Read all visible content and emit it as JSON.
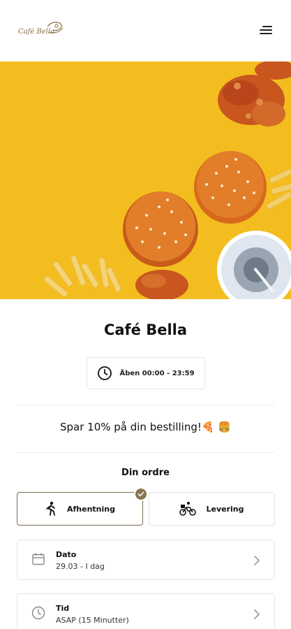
{
  "header": {
    "logo_text": "Café Bella",
    "menu_icon": "hamburger-menu-icon"
  },
  "hero": {
    "icon": "food-banner-image"
  },
  "restaurant": {
    "name": "Café Bella",
    "hours": "Åben 00:00 - 23:59"
  },
  "promo": {
    "text": "Spar 10% på din bestilling!🍕 🍔"
  },
  "order": {
    "title": "Din ordre",
    "options": [
      {
        "label": "Afhentning",
        "icon": "walking-icon",
        "selected": true
      },
      {
        "label": "Levering",
        "icon": "bicycle-delivery-icon",
        "selected": false
      }
    ],
    "date": {
      "label": "Dato",
      "value": "29.03 - I dag",
      "icon": "calendar-icon"
    },
    "time": {
      "label": "Tid",
      "value": "ASAP (15 Minutter)",
      "icon": "clock-icon"
    }
  },
  "colors": {
    "accent": "#8a7550",
    "hero_background": "#f3bd1f",
    "text": "#111111"
  }
}
